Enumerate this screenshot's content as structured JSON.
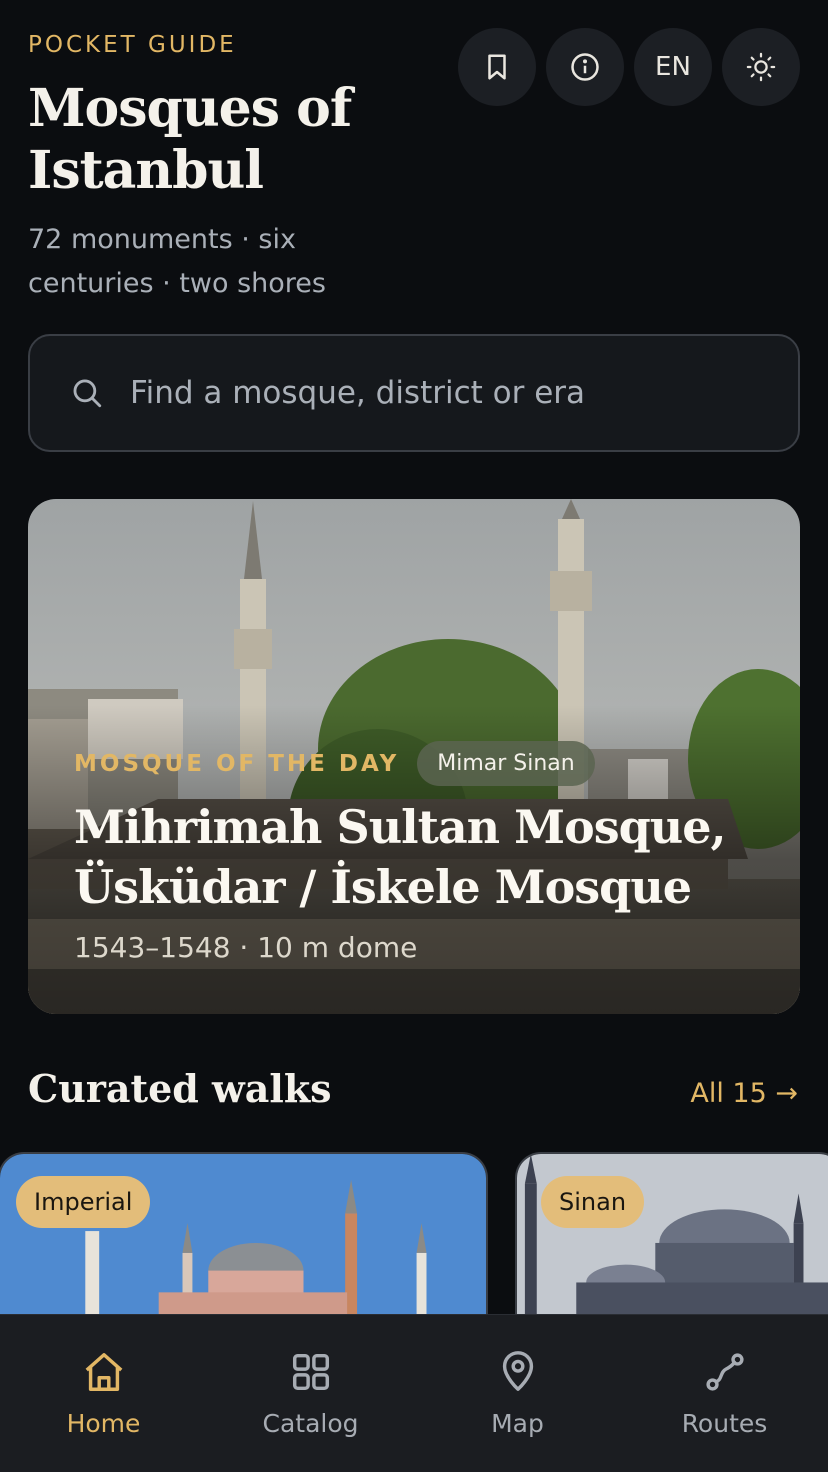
{
  "header": {
    "eyebrow": "POCKET GUIDE",
    "title": "Mosques of Istanbul",
    "subtitle": "72 monuments · six centuries · two shores",
    "actions": {
      "bookmark_icon": "bookmark-icon",
      "info_icon": "info-icon",
      "language": "EN",
      "theme_icon": "sun-icon"
    }
  },
  "search": {
    "placeholder": "Find a mosque, district or era",
    "icon": "search-icon"
  },
  "hero": {
    "eyebrow": "MOSQUE OF THE DAY",
    "architect": "Mimar Sinan",
    "title": "Mihrimah Sultan Mosque, Üsküdar / İskele Mosque",
    "meta": "1543–1548 · 10 m dome"
  },
  "walks": {
    "title": "Curated walks",
    "link": "All 15 →",
    "cards": [
      {
        "tag": "Imperial"
      },
      {
        "tag": "Sinan"
      }
    ]
  },
  "tabbar": {
    "items": [
      {
        "label": "Home",
        "icon": "home-icon",
        "active": true
      },
      {
        "label": "Catalog",
        "icon": "grid-icon",
        "active": false
      },
      {
        "label": "Map",
        "icon": "map-pin-icon",
        "active": false
      },
      {
        "label": "Routes",
        "icon": "route-icon",
        "active": false
      }
    ]
  },
  "colors": {
    "background": "#0b0d10",
    "accent": "#e2b765",
    "surface": "#1c1f24",
    "tag": "#e3bd7a"
  }
}
